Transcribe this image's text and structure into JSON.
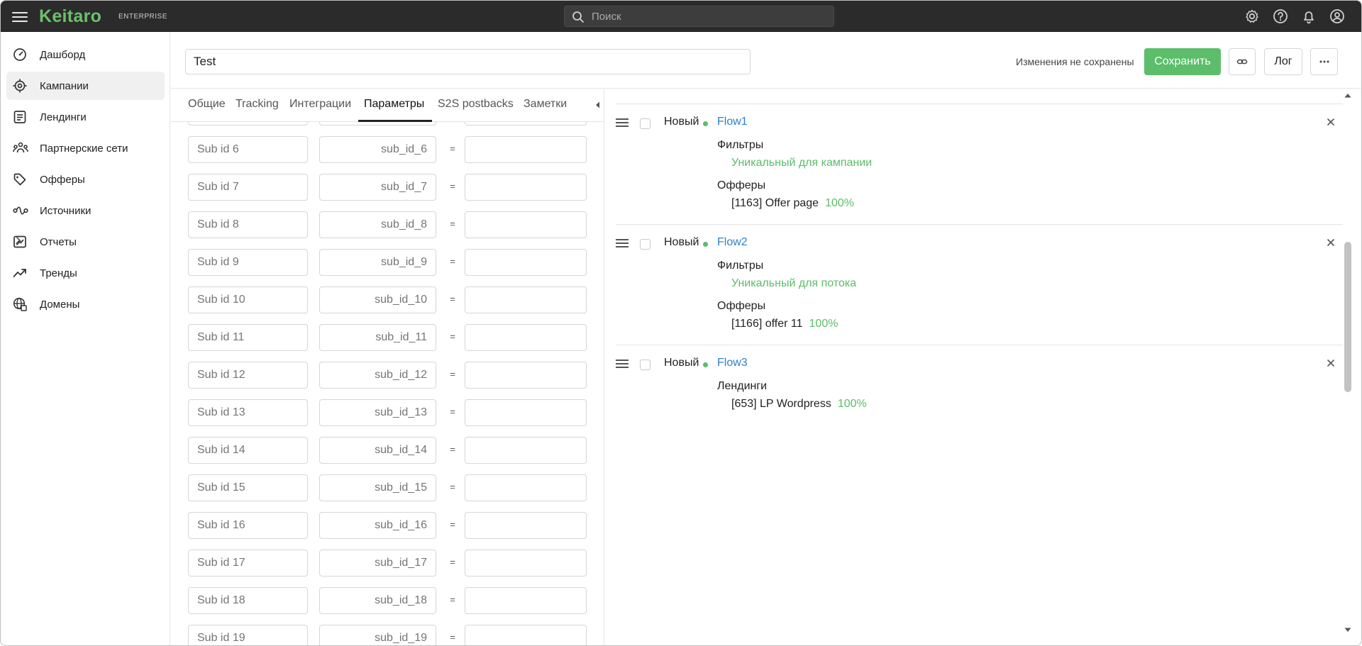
{
  "topbar": {
    "logo": "Keitaro",
    "edition": "ENTERPRISE",
    "search_placeholder": "Поиск"
  },
  "sidebar": {
    "items": [
      {
        "label": "Дашборд",
        "icon": "dashboard-icon"
      },
      {
        "label": "Кампании",
        "icon": "target-icon",
        "active": true
      },
      {
        "label": "Лендинги",
        "icon": "landing-icon"
      },
      {
        "label": "Партнерские сети",
        "icon": "network-icon"
      },
      {
        "label": "Офферы",
        "icon": "tag-icon"
      },
      {
        "label": "Источники",
        "icon": "source-icon"
      },
      {
        "label": "Отчеты",
        "icon": "report-icon",
        "has_submenu": true
      },
      {
        "label": "Тренды",
        "icon": "trend-icon"
      },
      {
        "label": "Домены",
        "icon": "domain-icon"
      }
    ]
  },
  "header": {
    "campaign_name": "Test",
    "unsaved_text": "Изменения не сохранены",
    "save_label": "Сохранить",
    "log_label": "Лог"
  },
  "tabs": [
    "Общие",
    "Tracking",
    "Интеграции",
    "Параметры",
    "S2S postbacks",
    "Заметки"
  ],
  "active_tab": "Параметры",
  "params": [
    {
      "name": "Sub id 6",
      "key": "sub_id_6"
    },
    {
      "name": "Sub id 7",
      "key": "sub_id_7"
    },
    {
      "name": "Sub id 8",
      "key": "sub_id_8"
    },
    {
      "name": "Sub id 9",
      "key": "sub_id_9"
    },
    {
      "name": "Sub id 10",
      "key": "sub_id_10"
    },
    {
      "name": "Sub id 11",
      "key": "sub_id_11"
    },
    {
      "name": "Sub id 12",
      "key": "sub_id_12"
    },
    {
      "name": "Sub id 13",
      "key": "sub_id_13"
    },
    {
      "name": "Sub id 14",
      "key": "sub_id_14"
    },
    {
      "name": "Sub id 15",
      "key": "sub_id_15"
    },
    {
      "name": "Sub id 16",
      "key": "sub_id_16"
    },
    {
      "name": "Sub id 17",
      "key": "sub_id_17"
    },
    {
      "name": "Sub id 18",
      "key": "sub_id_18"
    },
    {
      "name": "Sub id 19",
      "key": "sub_id_19"
    }
  ],
  "param_separator": "=",
  "flows": [
    {
      "state": "Новый",
      "name": "Flow1",
      "sections": [
        {
          "title": "Фильтры",
          "lines": [
            {
              "text": "Уникальный для кампании",
              "green": true
            }
          ]
        },
        {
          "title": "Офферы",
          "lines": [
            {
              "text": "[1163] Offer page",
              "pct": "100%"
            }
          ]
        }
      ]
    },
    {
      "state": "Новый",
      "name": "Flow2",
      "sections": [
        {
          "title": "Фильтры",
          "lines": [
            {
              "text": "Уникальный для потока",
              "green": true
            }
          ]
        },
        {
          "title": "Офферы",
          "lines": [
            {
              "text": "[1166] offer 11",
              "pct": "100%"
            }
          ]
        }
      ]
    },
    {
      "state": "Новый",
      "name": "Flow3",
      "sections": [
        {
          "title": "Лендинги",
          "lines": [
            {
              "text": "[653] LP Wordpress",
              "pct": "100%"
            }
          ]
        }
      ]
    }
  ],
  "colors": {
    "brand_green": "#6cc06b",
    "save_green": "#5cbd6a",
    "link_blue": "#2f80c8",
    "topbar_bg": "#2b2b2b"
  }
}
